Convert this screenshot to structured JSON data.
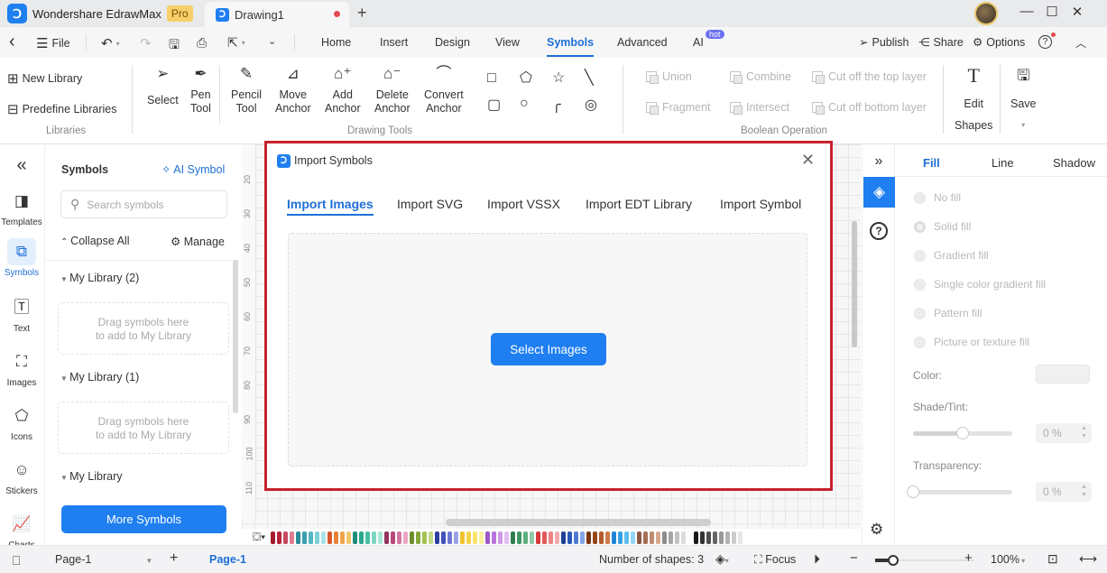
{
  "titlebar": {
    "app_name": "Wondershare EdrawMax",
    "pro_badge": "Pro",
    "doc_tab": "Drawing1",
    "new_tab": "+",
    "win_min": "—",
    "win_max": "☐",
    "win_close": "✕"
  },
  "menubar": {
    "back": "‹",
    "file": "File",
    "ribbon_tabs": [
      "Home",
      "Insert",
      "Design",
      "View",
      "Symbols",
      "Advanced",
      "AI"
    ],
    "active_tab": "Symbols",
    "ai_badge": "hot",
    "publish": "Publish",
    "share": "Share",
    "options": "Options",
    "help": "?"
  },
  "ribbon": {
    "libraries": {
      "new_library": "New Library",
      "predefine_libraries": "Predefine Libraries",
      "group_label": "Libraries"
    },
    "tools": [
      {
        "line1": "Select",
        "line2": ""
      },
      {
        "line1": "Pen",
        "line2": "Tool"
      },
      {
        "line1": "Pencil",
        "line2": "Tool"
      },
      {
        "line1": "Move",
        "line2": "Anchor"
      },
      {
        "line1": "Add",
        "line2": "Anchor"
      },
      {
        "line1": "Delete",
        "line2": "Anchor"
      },
      {
        "line1": "Convert",
        "line2": "Anchor"
      }
    ],
    "drawing_tools_label": "Drawing Tools",
    "shapes": [
      "rectangle",
      "pentagon",
      "star",
      "line",
      "rounded-rectangle",
      "circle",
      "arc",
      "spiral"
    ],
    "boolean": [
      "Union",
      "Combine",
      "Cut off the top layer",
      "Fragment",
      "Intersect",
      "Cut off bottom layer"
    ],
    "boolean_label": "Boolean Operation",
    "edit_shapes": {
      "line1": "Edit",
      "line2": "Shapes"
    },
    "save": "Save"
  },
  "leftnav": {
    "collapse": "«",
    "items": [
      {
        "label": "Templates",
        "icon": "templates-icon"
      },
      {
        "label": "Symbols",
        "icon": "symbols-icon"
      },
      {
        "label": "Text",
        "icon": "text-icon"
      },
      {
        "label": "Images",
        "icon": "images-icon"
      },
      {
        "label": "Icons",
        "icon": "icons-icon"
      },
      {
        "label": "Stickers",
        "icon": "stickers-icon"
      },
      {
        "label": "Charts",
        "icon": "charts-icon"
      }
    ],
    "active": "Symbols"
  },
  "symbols_panel": {
    "title": "Symbols",
    "ai_symbol": "AI Symbol",
    "search_placeholder": "Search symbols",
    "collapse_all": "Collapse All",
    "manage": "Manage",
    "libraries": [
      {
        "name": "My Library (2)",
        "drop_hint_1": "Drag symbols here",
        "drop_hint_2": "to add to My Library"
      },
      {
        "name": "My Library (1)",
        "drop_hint_1": "Drag symbols here",
        "drop_hint_2": "to add to My Library"
      },
      {
        "name": "My Library"
      }
    ],
    "more_symbols": "More Symbols"
  },
  "ruler": {
    "vertical_ticks": [
      "20",
      "30",
      "40",
      "50",
      "60",
      "70",
      "80",
      "90",
      "100",
      "110"
    ]
  },
  "dialog": {
    "title": "Import Symbols",
    "close": "✕",
    "tabs": [
      "Import Images",
      "Import SVG",
      "Import VSSX",
      "Import EDT Library",
      "Import Symbol"
    ],
    "active_tab": "Import Images",
    "select_button": "Select Images"
  },
  "palette": {
    "colors": [
      "#a51d2d",
      "#b8243a",
      "#c8485e",
      "#e07a8e",
      "#2e8a9a",
      "#3a9fb0",
      "#55b7c5",
      "#7fcfd8",
      "#a9e3e8",
      "#d9572e",
      "#e6833a",
      "#eea54a",
      "#f2c46b",
      "#1e8f7a",
      "#2aa68c",
      "#48bea1",
      "#7ed6c0",
      "#a8e6d6",
      "#93345e",
      "#b74a79",
      "#d476a0",
      "#eaa7c4",
      "#6e8e2b",
      "#86a83a",
      "#a2c251",
      "#c2d985",
      "#2e3d9e",
      "#4351b8",
      "#6d78d0",
      "#9aa2e2",
      "#f2c12e",
      "#f5d34a",
      "#f8e36e",
      "#fbf09c",
      "#9d58c6",
      "#b774da",
      "#cf98e8",
      "#e2bdf1",
      "#2e7d4f",
      "#3d9663",
      "#5db07f",
      "#8fcaa6",
      "#d63a3a",
      "#e35a5a",
      "#ec8484",
      "#f2abab",
      "#1d3f94",
      "#2b58b8",
      "#4d7bd3",
      "#84a6e6",
      "#7a3412",
      "#964519",
      "#b35b2c",
      "#cc7a4c",
      "#1f86d6",
      "#33a0e6",
      "#5cbcf0",
      "#93d6f7",
      "#8a5a44",
      "#a56f56",
      "#c08a6f",
      "#d8a98f",
      "#8c8c8c",
      "#a6a6a6",
      "#c2c2c2",
      "#dcdcdc",
      "#ffffff",
      "#1a1a1a",
      "#333333",
      "#4d4d4d",
      "#666666",
      "#999999",
      "#b3b3b3",
      "#cccccc",
      "#e6e6e6"
    ]
  },
  "properties": {
    "tabs": [
      "Fill",
      "Line",
      "Shadow"
    ],
    "active_tab": "Fill",
    "fill_options": [
      "No fill",
      "Solid fill",
      "Gradient fill",
      "Single color gradient fill",
      "Pattern fill",
      "Picture or texture fill"
    ],
    "selected_fill": "Solid fill",
    "color_label": "Color:",
    "shade_label": "Shade/Tint:",
    "shade_value": "0 %",
    "shade_slider": 0.5,
    "transparency_label": "Transparency:",
    "transparency_value": "0 %",
    "transparency_slider": 0
  },
  "statusbar": {
    "page_select": "Page-1",
    "add_page": "+",
    "page_tab": "Page-1",
    "shape_count": "Number of shapes: 3",
    "focus": "Focus",
    "zoom_out": "−",
    "zoom_in": "+",
    "zoom_level": "100%"
  }
}
